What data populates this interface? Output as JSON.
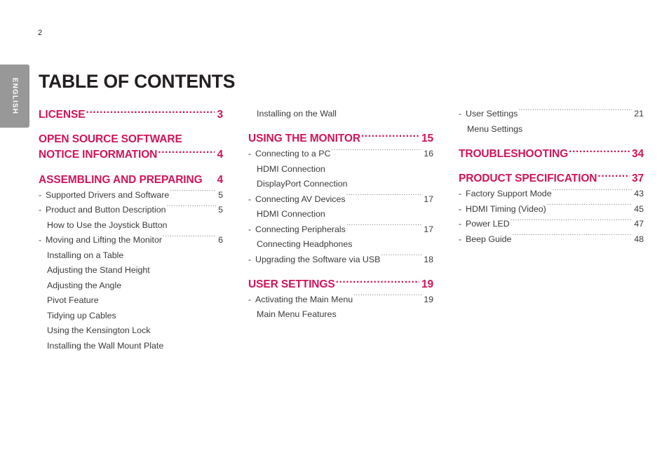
{
  "page": {
    "number": "2",
    "title": "TABLE OF CONTENTS",
    "language_tab": "ENGLISH",
    "accent_color": "#d1145a",
    "text_color": "#231f20",
    "tab_background": "#989898"
  },
  "columns": [
    {
      "entries": [
        {
          "type": "major",
          "label": "LICENSE",
          "page": "3"
        },
        {
          "type": "major_wrap",
          "line1": "OPEN SOURCE SOFTWARE",
          "label": "NOTICE INFORMATION",
          "page": "4"
        },
        {
          "type": "major_nodots",
          "label": "ASSEMBLING AND PREPARING",
          "page": "4"
        },
        {
          "type": "sub",
          "label": "Supported Drivers and Software",
          "page": "5"
        },
        {
          "type": "sub",
          "label": "Product and Button Description",
          "page": "5"
        },
        {
          "type": "leaf",
          "label": "How to Use the Joystick Button"
        },
        {
          "type": "sub",
          "label": "Moving and Lifting the Monitor",
          "page": "6"
        },
        {
          "type": "leaf",
          "label": "Installing on a Table"
        },
        {
          "type": "leaf",
          "label": "Adjusting the Stand Height"
        },
        {
          "type": "leaf",
          "label": "Adjusting the Angle"
        },
        {
          "type": "leaf",
          "label": "Pivot Feature"
        },
        {
          "type": "leaf",
          "label": "Tidying up Cables"
        },
        {
          "type": "leaf",
          "label": "Using the Kensington Lock"
        },
        {
          "type": "leaf",
          "label": "Installing the Wall Mount Plate"
        }
      ]
    },
    {
      "entries": [
        {
          "type": "leaf",
          "label": "Installing on the Wall"
        },
        {
          "type": "major",
          "label": "USING THE MONITOR",
          "page": "15"
        },
        {
          "type": "sub",
          "label": "Connecting to a PC",
          "page": "16"
        },
        {
          "type": "leaf",
          "label": "HDMI Connection"
        },
        {
          "type": "leaf",
          "label": "DisplayPort Connection"
        },
        {
          "type": "sub",
          "label": "Connecting AV Devices",
          "page": "17"
        },
        {
          "type": "leaf",
          "label": "HDMI Connection"
        },
        {
          "type": "sub",
          "label": "Connecting Peripherals",
          "page": "17"
        },
        {
          "type": "leaf",
          "label": "Connecting Headphones"
        },
        {
          "type": "sub",
          "label": "Upgrading the Software via USB",
          "page": "18"
        },
        {
          "type": "major",
          "label": "USER SETTINGS",
          "page": "19"
        },
        {
          "type": "sub",
          "label": "Activating the Main Menu",
          "page": "19"
        },
        {
          "type": "leaf",
          "label": "Main Menu Features"
        }
      ]
    },
    {
      "entries": [
        {
          "type": "sub",
          "label": "User Settings",
          "page": "21"
        },
        {
          "type": "leaf",
          "label": "Menu Settings"
        },
        {
          "type": "major",
          "label": "TROUBLESHOOTING",
          "page": "34"
        },
        {
          "type": "major",
          "label": "PRODUCT SPECIFICATION",
          "page": "37"
        },
        {
          "type": "sub",
          "label": "Factory Support Mode",
          "page": "43"
        },
        {
          "type": "sub",
          "label": "HDMI Timing (Video)",
          "page": "45"
        },
        {
          "type": "sub",
          "label": "Power LED",
          "page": "47"
        },
        {
          "type": "sub",
          "label": "Beep Guide",
          "page": "48"
        }
      ]
    }
  ]
}
